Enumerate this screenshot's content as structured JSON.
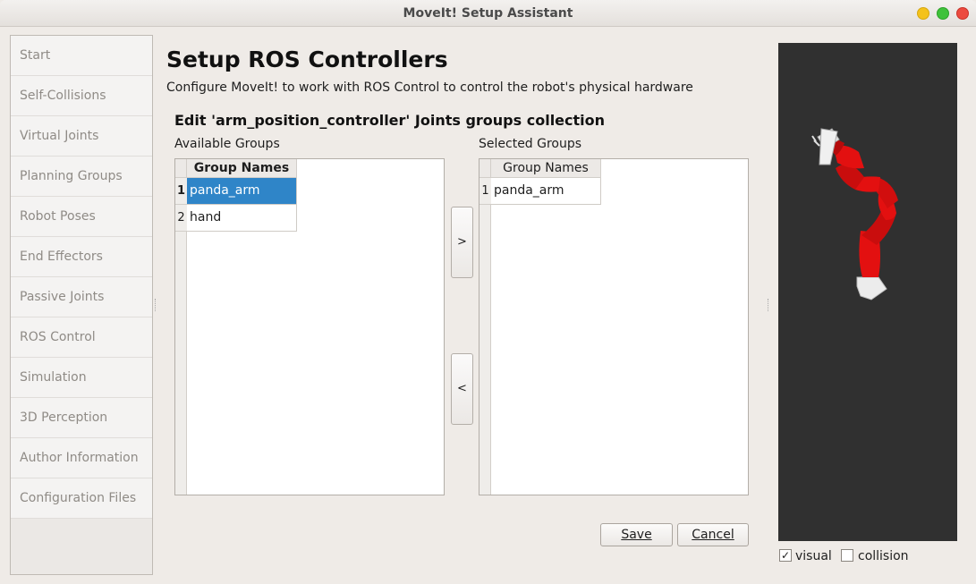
{
  "window": {
    "title": "MoveIt! Setup Assistant"
  },
  "sidebar": {
    "items": [
      {
        "label": "Start"
      },
      {
        "label": "Self-Collisions"
      },
      {
        "label": "Virtual Joints"
      },
      {
        "label": "Planning Groups"
      },
      {
        "label": "Robot Poses"
      },
      {
        "label": "End Effectors"
      },
      {
        "label": "Passive Joints"
      },
      {
        "label": "ROS Control"
      },
      {
        "label": "Simulation"
      },
      {
        "label": "3D Perception"
      },
      {
        "label": "Author Information"
      },
      {
        "label": "Configuration Files"
      }
    ]
  },
  "main": {
    "title": "Setup ROS Controllers",
    "subtitle": "Configure MoveIt! to work with ROS Control to control the robot's physical hardware",
    "section_title": "Edit 'arm_position_controller' Joints groups collection",
    "available": {
      "label": "Available Groups",
      "column": "Group Names",
      "rows": [
        {
          "num": "1",
          "name": "panda_arm",
          "selected": true
        },
        {
          "num": "2",
          "name": "hand",
          "selected": false
        }
      ]
    },
    "selected": {
      "label": "Selected Groups",
      "column": "Group Names",
      "rows": [
        {
          "num": "1",
          "name": "panda_arm"
        }
      ]
    },
    "add_label": ">",
    "remove_label": "<",
    "save_label": "Save",
    "cancel_label": "Cancel"
  },
  "viewer": {
    "visual_label": "visual",
    "visual_checked": "✓",
    "collision_label": "collision",
    "robot_color": "#e31010",
    "background": "#303030"
  }
}
